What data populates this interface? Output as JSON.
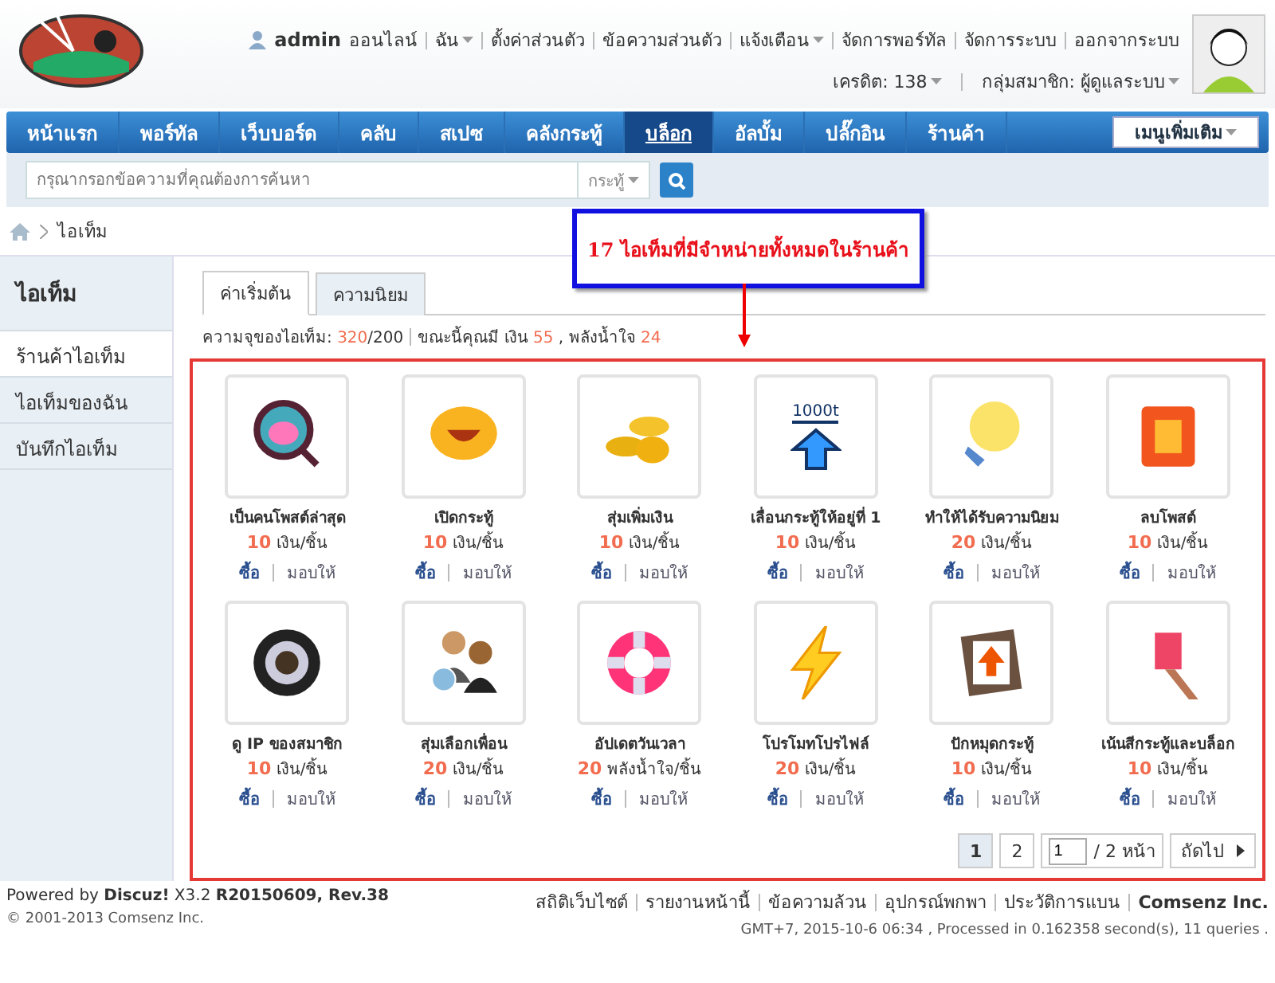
{
  "header": {
    "user": {
      "name": "admin",
      "status": "ออนไลน์"
    },
    "links": [
      {
        "label": "ฉัน",
        "dropdown": true
      },
      {
        "label": "ตั้งค่าส่วนตัว",
        "dropdown": false
      },
      {
        "label": "ข้อความส่วนตัว",
        "dropdown": false
      },
      {
        "label": "แจ้งเตือน",
        "dropdown": true
      },
      {
        "label": "จัดการพอร์ทัล",
        "dropdown": false
      },
      {
        "label": "จัดการระบบ",
        "dropdown": false
      },
      {
        "label": "ออกจากระบบ",
        "dropdown": false
      }
    ],
    "stats": [
      {
        "label": "เครดิต: 138",
        "dropdown": true
      },
      {
        "label": "กลุ่มสมาชิก: ผู้ดูแลระบบ",
        "dropdown": true
      }
    ]
  },
  "nav": {
    "items": [
      {
        "label": "หน้าแรก",
        "selected": false
      },
      {
        "label": "พอร์ทัล",
        "selected": false
      },
      {
        "label": "เว็บบอร์ด",
        "selected": false
      },
      {
        "label": "คลับ",
        "selected": false
      },
      {
        "label": "สเปซ",
        "selected": false
      },
      {
        "label": "คลังกระทู้",
        "selected": false
      },
      {
        "label": "บล็อก",
        "selected": true
      },
      {
        "label": "อัลบั้ม",
        "selected": false
      },
      {
        "label": "ปลั๊กอิน",
        "selected": false
      },
      {
        "label": "ร้านค้า",
        "selected": false
      }
    ],
    "more": "เมนูเพิ่มเติม"
  },
  "search": {
    "placeholder": "กรุณากรอกข้อความที่คุณต้องการค้นหา",
    "scope": "กระทู้"
  },
  "breadcrumb": [
    "ไอเท็ม"
  ],
  "sidebar": {
    "title": "ไอเท็ม",
    "items": [
      {
        "label": "ร้านค้าไอเท็ม",
        "selected": true
      },
      {
        "label": "ไอเท็มของฉัน",
        "selected": false
      },
      {
        "label": "บันทึกไอเท็ม",
        "selected": false
      }
    ]
  },
  "tabs": [
    {
      "label": "ค่าเริ่มต้น",
      "selected": true
    },
    {
      "label": "ความนิยม",
      "selected": false
    }
  ],
  "summary": {
    "label": "ความจุของไอเท็ม:",
    "used": "320",
    "capacity": "/200",
    "wallet": "ขณะนี้คุณมี เงิน",
    "money": "55",
    "goodwill_label": ", พลังน้ำใจ",
    "goodwill": "24"
  },
  "callout": "17 ไอเท็มที่มีจำหน่ายทั้งหมดในร้านค้า",
  "items": [
    {
      "name": "เป็นคนโพสต์ล่าสุด",
      "price": "10",
      "unit": "เงิน/ชิ้น",
      "buy": "ซื้อ",
      "give": "มอบให้"
    },
    {
      "name": "เปิดกระทู้",
      "price": "10",
      "unit": "เงิน/ชิ้น",
      "buy": "ซื้อ",
      "give": "มอบให้"
    },
    {
      "name": "สุ่มเพิ่มเงิน",
      "price": "10",
      "unit": "เงิน/ชิ้น",
      "buy": "ซื้อ",
      "give": "มอบให้"
    },
    {
      "name": "เลื่อนกระทู้ให้อยู่ที่ 1",
      "price": "10",
      "unit": "เงิน/ชิ้น",
      "buy": "ซื้อ",
      "give": "มอบให้",
      "icon_text": "1000t"
    },
    {
      "name": "ทำให้ได้รับความนิยม",
      "price": "20",
      "unit": "เงิน/ชิ้น",
      "buy": "ซื้อ",
      "give": "มอบให้"
    },
    {
      "name": "ลบโพสต์",
      "price": "10",
      "unit": "เงิน/ชิ้น",
      "buy": "ซื้อ",
      "give": "มอบให้"
    },
    {
      "name": "ดู IP ของสมาชิก",
      "price": "10",
      "unit": "เงิน/ชิ้น",
      "buy": "ซื้อ",
      "give": "มอบให้"
    },
    {
      "name": "สุ่มเลือกเพื่อน",
      "price": "20",
      "unit": "เงิน/ชิ้น",
      "buy": "ซื้อ",
      "give": "มอบให้"
    },
    {
      "name": "อัปเดตวันเวลา",
      "price": "20",
      "unit": "พลังน้ำใจ/ชิ้น",
      "buy": "ซื้อ",
      "give": "มอบให้"
    },
    {
      "name": "โปรโมทโปรไฟล์",
      "price": "20",
      "unit": "เงิน/ชิ้น",
      "buy": "ซื้อ",
      "give": "มอบให้"
    },
    {
      "name": "ปักหมุดกระทู้",
      "price": "10",
      "unit": "เงิน/ชิ้น",
      "buy": "ซื้อ",
      "give": "มอบให้"
    },
    {
      "name": "เน้นสีกระทู้และบล็อก",
      "price": "10",
      "unit": "เงิน/ชิ้น",
      "buy": "ซื้อ",
      "give": "มอบให้"
    }
  ],
  "pagination": {
    "pages": [
      {
        "label": "1",
        "selected": true
      },
      {
        "label": "2",
        "selected": false
      }
    ],
    "input": "1",
    "total": "/ 2 หน้า",
    "next": "ถัดไป"
  },
  "footer": {
    "powered": "Powered by **Discuz!** X3.2 **R20150609, Rev.38**",
    "copyright": "© 2001-2013 Comsenz Inc.",
    "links": [
      "สถิติเว็บไซต์",
      "รายงานหน้านี้",
      "ข้อความล้วน",
      "อุปกรณ์พกพา",
      "ประวัติการแบน"
    ],
    "company": "Comsenz Inc.",
    "info": "GMT+7, 2015-10-6 06:34 , Processed in 0.162358 second(s), 11 queries ."
  }
}
